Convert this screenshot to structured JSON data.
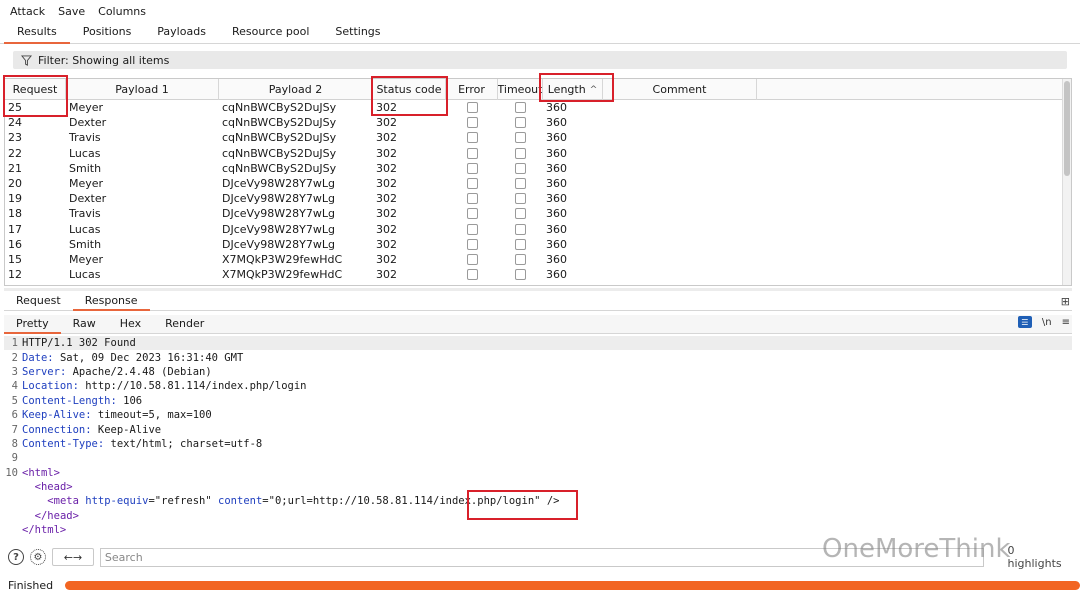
{
  "menu": [
    "Attack",
    "Save",
    "Columns"
  ],
  "top_tabs": [
    {
      "label": "Results",
      "active": true
    },
    {
      "label": "Positions",
      "active": false
    },
    {
      "label": "Payloads",
      "active": false
    },
    {
      "label": "Resource pool",
      "active": false
    },
    {
      "label": "Settings",
      "active": false
    }
  ],
  "filter": {
    "label": "Filter: Showing all items"
  },
  "table": {
    "columns": [
      "Request",
      "Payload 1",
      "Payload 2",
      "Status code",
      "Error",
      "Timeout",
      "Length",
      "Comment"
    ],
    "rows": [
      {
        "request": "25",
        "payload1": "Meyer",
        "payload2": "cqNnBWCByS2DuJSy",
        "status": "302",
        "length": "360"
      },
      {
        "request": "24",
        "payload1": "Dexter",
        "payload2": "cqNnBWCByS2DuJSy",
        "status": "302",
        "length": "360"
      },
      {
        "request": "23",
        "payload1": "Travis",
        "payload2": "cqNnBWCByS2DuJSy",
        "status": "302",
        "length": "360"
      },
      {
        "request": "22",
        "payload1": "Lucas",
        "payload2": "cqNnBWCByS2DuJSy",
        "status": "302",
        "length": "360"
      },
      {
        "request": "21",
        "payload1": "Smith",
        "payload2": "cqNnBWCByS2DuJSy",
        "status": "302",
        "length": "360"
      },
      {
        "request": "20",
        "payload1": "Meyer",
        "payload2": "DJceVy98W28Y7wLg",
        "status": "302",
        "length": "360"
      },
      {
        "request": "19",
        "payload1": "Dexter",
        "payload2": "DJceVy98W28Y7wLg",
        "status": "302",
        "length": "360"
      },
      {
        "request": "18",
        "payload1": "Travis",
        "payload2": "DJceVy98W28Y7wLg",
        "status": "302",
        "length": "360"
      },
      {
        "request": "17",
        "payload1": "Lucas",
        "payload2": "DJceVy98W28Y7wLg",
        "status": "302",
        "length": "360"
      },
      {
        "request": "16",
        "payload1": "Smith",
        "payload2": "DJceVy98W28Y7wLg",
        "status": "302",
        "length": "360"
      },
      {
        "request": "15",
        "payload1": "Meyer",
        "payload2": "X7MQkP3W29fewHdC",
        "status": "302",
        "length": "360"
      },
      {
        "request": "12",
        "payload1": "Lucas",
        "payload2": "X7MQkP3W29fewHdC",
        "status": "302",
        "length": "360"
      }
    ]
  },
  "mid_tabs": [
    {
      "label": "Request",
      "active": false
    },
    {
      "label": "Response",
      "active": true
    }
  ],
  "sub_tabs": [
    {
      "label": "Pretty",
      "active": true
    },
    {
      "label": "Raw",
      "active": false
    },
    {
      "label": "Hex",
      "active": false
    },
    {
      "label": "Render",
      "active": false
    }
  ],
  "viewer_icons": {
    "newline": "\\n",
    "wrap": "☰"
  },
  "response": {
    "status_line": "HTTP/1.1 302 Found",
    "headers": [
      {
        "name": "Date",
        "value": " Sat, 09 Dec 2023 16:31:40 GMT"
      },
      {
        "name": "Server",
        "value": " Apache/2.4.48 (Debian)"
      },
      {
        "name": "Location",
        "value": " http://10.58.81.114/index.php/login"
      },
      {
        "name": "Content-Length",
        "value": " 106"
      },
      {
        "name": "Keep-Alive",
        "value": " timeout=5, max=100"
      },
      {
        "name": "Connection",
        "value": " Keep-Alive"
      },
      {
        "name": "Content-Type",
        "value": " text/html; charset=utf-8"
      }
    ],
    "html_open": "<html>",
    "head_open": "<head>",
    "meta_tag": "meta",
    "meta_attr1": "http-equiv",
    "meta_val1": "\"refresh\"",
    "meta_attr2": "content",
    "meta_val2a": "\"0;url=http://10.58.81.114",
    "meta_val2b": "/index.php/login",
    "meta_val2c": "\"",
    "meta_close": "/>",
    "head_close": "</head>",
    "html_close": "</html>"
  },
  "search": {
    "placeholder": "Search"
  },
  "highlights": "0 highlights",
  "watermark": "OneMoreThink",
  "status": "Finished",
  "progress": 1.0,
  "colors": {
    "accent": "#e8663c",
    "progress": "#f26522",
    "annotation": "#d8202a"
  }
}
